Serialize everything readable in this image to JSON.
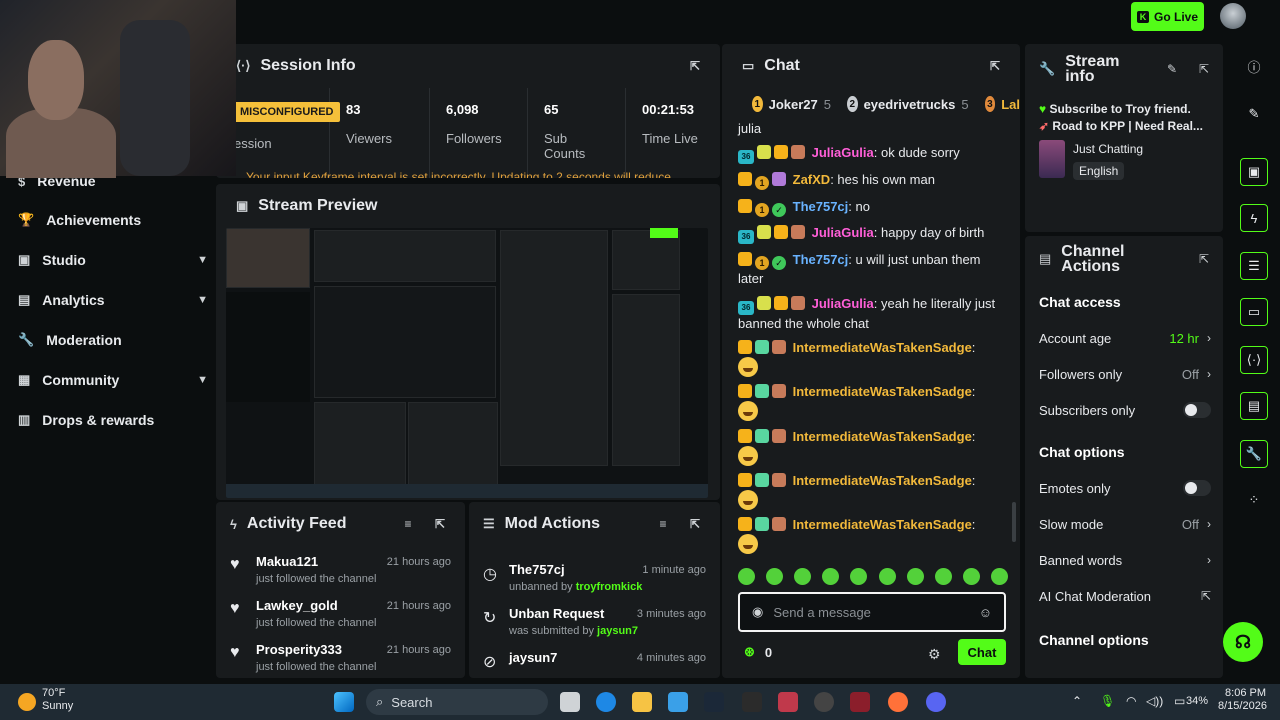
{
  "topbar": {
    "go_live_label": "Go Live"
  },
  "sidebar": {
    "items": [
      {
        "label": "Revenue",
        "icon": "dollar-icon",
        "has_chevron": false
      },
      {
        "label": "Achievements",
        "icon": "trophy-icon",
        "has_chevron": false
      },
      {
        "label": "Studio",
        "icon": "studio-icon",
        "has_chevron": true
      },
      {
        "label": "Analytics",
        "icon": "chart-icon",
        "has_chevron": true
      },
      {
        "label": "Moderation",
        "icon": "wrench-icon",
        "has_chevron": false
      },
      {
        "label": "Community",
        "icon": "community-icon",
        "has_chevron": true
      },
      {
        "label": "Drops & rewards",
        "icon": "gift-icon",
        "has_chevron": false
      }
    ]
  },
  "session_info": {
    "title": "Session Info",
    "status_badge": "MISCONFIGURED",
    "status_sub": "ession",
    "stats": [
      {
        "value": "83",
        "label": "Viewers"
      },
      {
        "value": "6,098",
        "label": "Followers"
      },
      {
        "value": "65",
        "label": "Sub Counts"
      },
      {
        "value": "00:21:53",
        "label": "Time Live"
      }
    ],
    "warning": "Your input Keyframe interval is set incorrectly. Updating to 2 seconds will reduce"
  },
  "stream_preview": {
    "title": "Stream Preview"
  },
  "activity_feed": {
    "title": "Activity Feed",
    "rows": [
      {
        "name": "Makua121",
        "sub": "just followed the channel",
        "time": "21 hours ago"
      },
      {
        "name": "Lawkey_gold",
        "sub": "just followed the channel",
        "time": "21 hours ago"
      },
      {
        "name": "Prosperity333",
        "sub": "just followed the channel",
        "time": "21 hours ago"
      }
    ]
  },
  "mod_actions": {
    "title": "Mod Actions",
    "rows": [
      {
        "name": "The757cj",
        "action": "unbanned by",
        "actor": "troyfromkick",
        "time": "1 minute ago"
      },
      {
        "name": "Unban Request",
        "action": "was submitted by",
        "actor": "jaysun7",
        "time": "3 minutes ago"
      },
      {
        "name": "jaysun7",
        "action": "",
        "actor": "",
        "time": "4 minutes ago"
      }
    ]
  },
  "chat": {
    "title": "Chat",
    "leaderboard": [
      {
        "rank": "1",
        "name": "Joker27",
        "count": "5",
        "color": "#f2b93b"
      },
      {
        "rank": "2",
        "name": "eyedrivetrucks",
        "count": "5",
        "color": "#c9cdd1"
      },
      {
        "rank": "3",
        "name": "Lal",
        "count": "",
        "color": "#e08a3c"
      }
    ],
    "messages": [
      {
        "user": "",
        "text": "julia"
      },
      {
        "user": "JuliaGulia",
        "text": ": ok dude sorry"
      },
      {
        "user": "ZafXD",
        "text": ": hes his own man"
      },
      {
        "user": "The757cj",
        "text": ": no"
      },
      {
        "user": "JuliaGulia",
        "text": ": happy day of birth"
      },
      {
        "user": "The757cj",
        "text": ": u will just unban them later"
      },
      {
        "user": "JuliaGulia",
        "text": ": yeah he literally just banned the whole chat"
      },
      {
        "user": "IntermediateWasTakenSadge",
        "text": ":"
      },
      {
        "user": "IntermediateWasTakenSadge",
        "text": ":"
      },
      {
        "user": "IntermediateWasTakenSadge",
        "text": ":"
      },
      {
        "user": "IntermediateWasTakenSadge",
        "text": ":"
      },
      {
        "user": "IntermediateWasTakenSadge",
        "text": ":"
      }
    ],
    "badge_36": "36",
    "badge_1": "1",
    "input_placeholder": "Send a message",
    "points": "0",
    "send_label": "Chat"
  },
  "stream_info": {
    "title_line1": "Stream",
    "title_line2": "info",
    "line1": "Subscribe to Troy friend.",
    "line2": "Road to KPP | Need Real...",
    "category": "Just Chatting",
    "language": "English"
  },
  "channel_actions": {
    "title_line1": "Channel",
    "title_line2": "Actions",
    "chat_access_title": "Chat access",
    "rows": [
      {
        "label": "Account age",
        "value": "12 hr"
      },
      {
        "label": "Followers only",
        "value": "Off"
      },
      {
        "label": "Subscribers only",
        "value": ""
      }
    ],
    "chat_options_title": "Chat options",
    "option_rows": [
      {
        "label": "Emotes only",
        "value": ""
      },
      {
        "label": "Slow mode",
        "value": "Off"
      },
      {
        "label": "Banned words",
        "value": ""
      },
      {
        "label": "AI Chat Moderation",
        "value": ""
      }
    ],
    "channel_options_title": "Channel options"
  },
  "taskbar": {
    "weather_temp": "70°F",
    "weather_desc": "Sunny",
    "search_label": "Search",
    "battery": "34%",
    "time": "8:06 PM",
    "date": "8/15/2026"
  },
  "colors": {
    "accent": "#53fc18",
    "panel": "#181b1d",
    "background": "#0b0e0f",
    "warning": "#f5c03a"
  }
}
